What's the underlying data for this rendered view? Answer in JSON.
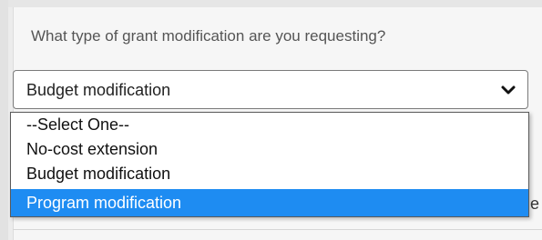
{
  "form": {
    "question": "What type of grant modification are you requesting?",
    "selected_value": "Budget modification",
    "options": [
      "--Select One--",
      "No-cost extension",
      "Budget modification",
      "Program modification"
    ],
    "highlighted_option": "Program modification",
    "clipped_text": "e"
  },
  "colors": {
    "highlight": "#1e8cf2",
    "page_bg": "#ececec"
  },
  "icons": {
    "dropdown": "chevron-down-icon"
  }
}
